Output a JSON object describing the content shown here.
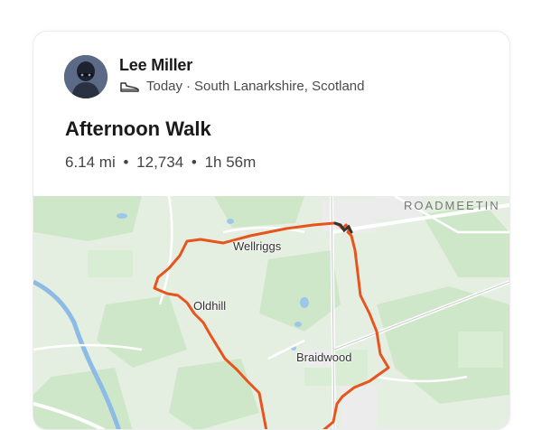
{
  "athlete": {
    "name": "Lee Miller",
    "date": "Today",
    "separator": "·",
    "location": "South Lanarkshire, Scotland"
  },
  "activity": {
    "title": "Afternoon Walk",
    "distance": "6.14 mi",
    "steps": "12,734",
    "duration": "1h 56m",
    "bullet": "•"
  },
  "map": {
    "labels": {
      "wellriggs": "Wellriggs",
      "oldhill": "Oldhill",
      "braidwood": "Braidwood",
      "road": "ROADMEETIN"
    },
    "route_color": "#e8541e",
    "water_color": "#9cc6ea",
    "park_color": "#c9e6c4"
  },
  "icons": {
    "activity_type": "shoe-icon"
  }
}
